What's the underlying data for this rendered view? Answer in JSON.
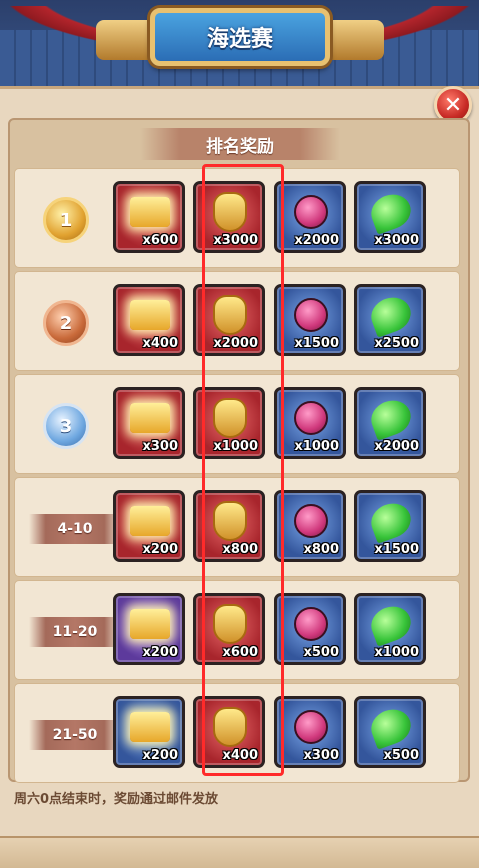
{
  "header": {
    "title": "海选赛"
  },
  "close_icon": "close-icon",
  "section_title": "排名奖励",
  "rows": [
    {
      "rank_label": "1",
      "rank_type": "medal-gold",
      "rewards": [
        {
          "icon": "chest-icon",
          "frame": "red",
          "qty": "x600"
        },
        {
          "icon": "crest-icon",
          "frame": "red",
          "qty": "x3000"
        },
        {
          "icon": "potion-icon",
          "frame": "blue",
          "qty": "x2000"
        },
        {
          "icon": "green-drop-icon",
          "frame": "blue",
          "qty": "x3000"
        }
      ]
    },
    {
      "rank_label": "2",
      "rank_type": "medal-bronze",
      "rewards": [
        {
          "icon": "chest-icon",
          "frame": "red",
          "qty": "x400"
        },
        {
          "icon": "crest-icon",
          "frame": "red",
          "qty": "x2000"
        },
        {
          "icon": "potion-icon",
          "frame": "blue",
          "qty": "x1500"
        },
        {
          "icon": "green-drop-icon",
          "frame": "blue",
          "qty": "x2500"
        }
      ]
    },
    {
      "rank_label": "3",
      "rank_type": "medal-silver",
      "rewards": [
        {
          "icon": "chest-icon",
          "frame": "red",
          "qty": "x300"
        },
        {
          "icon": "crest-icon",
          "frame": "red",
          "qty": "x1000"
        },
        {
          "icon": "potion-icon",
          "frame": "blue",
          "qty": "x1000"
        },
        {
          "icon": "green-drop-icon",
          "frame": "blue",
          "qty": "x2000"
        }
      ]
    },
    {
      "rank_label": "4-10",
      "rank_type": "ribbon",
      "rewards": [
        {
          "icon": "chest-icon",
          "frame": "red",
          "qty": "x200"
        },
        {
          "icon": "crest-icon",
          "frame": "red",
          "qty": "x800"
        },
        {
          "icon": "potion-icon",
          "frame": "blue",
          "qty": "x800"
        },
        {
          "icon": "green-drop-icon",
          "frame": "blue",
          "qty": "x1500"
        }
      ]
    },
    {
      "rank_label": "11-20",
      "rank_type": "ribbon",
      "rewards": [
        {
          "icon": "chest-icon",
          "frame": "purple",
          "qty": "x200"
        },
        {
          "icon": "crest-icon",
          "frame": "red",
          "qty": "x600"
        },
        {
          "icon": "potion-icon",
          "frame": "blue",
          "qty": "x500"
        },
        {
          "icon": "green-drop-icon",
          "frame": "blue",
          "qty": "x1000"
        }
      ]
    },
    {
      "rank_label": "21-50",
      "rank_type": "ribbon",
      "rewards": [
        {
          "icon": "chest-icon",
          "frame": "blue",
          "qty": "x200"
        },
        {
          "icon": "crest-icon",
          "frame": "red",
          "qty": "x400"
        },
        {
          "icon": "potion-icon",
          "frame": "blue",
          "qty": "x300"
        },
        {
          "icon": "green-drop-icon",
          "frame": "blue",
          "qty": "x500"
        }
      ]
    }
  ],
  "footer_note": "周六0点结束时，奖励通过邮件发放",
  "colors": {
    "highlight": "#ff2a2a",
    "panel": "#e8d7bf",
    "title_plate": "#2b6db5"
  }
}
